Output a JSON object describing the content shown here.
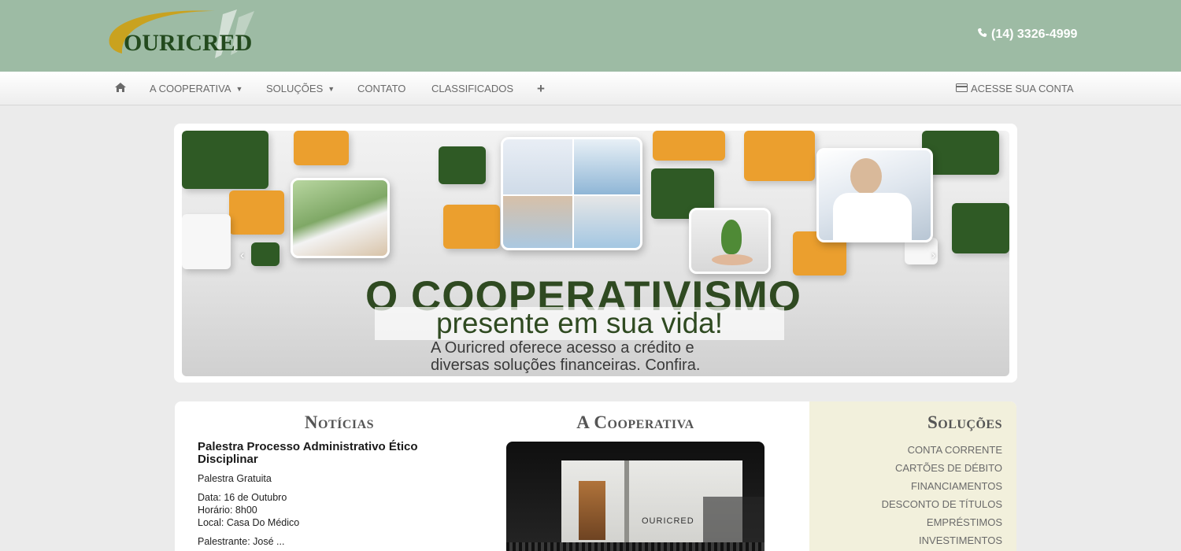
{
  "header": {
    "logo_text": "OURICRED",
    "phone": "(14) 3326-4999",
    "phone_icon": "phone-icon",
    "bg_color": "#9dbba4"
  },
  "nav": {
    "home_icon": "home-icon",
    "items": [
      {
        "label": "A COOPERATIVA",
        "dropdown": true
      },
      {
        "label": "SOLUÇÕES",
        "dropdown": true
      },
      {
        "label": "CONTATO",
        "dropdown": false
      },
      {
        "label": "CLASSIFICADOS",
        "dropdown": false
      }
    ],
    "more_label": "+",
    "account_label": "ACESSE SUA CONTA",
    "account_icon": "credit-card-icon"
  },
  "carousel": {
    "title": "O COOPERATIVISMO",
    "subtitle": "presente em sua vida!",
    "description_line1": "A Ouricred oferece acesso a crédito e",
    "description_line2": "diversas soluções financeiras. Confira.",
    "prev_label": "‹",
    "next_label": "›",
    "accent_green": "#2f5a25",
    "accent_orange": "#eb9f2e"
  },
  "noticias": {
    "title": "Notícias",
    "headline": "Palestra Processo Administrativo Ético Disciplinar",
    "lines": [
      "Palestra Gratuita",
      "Data: 16 de Outubro",
      "Horário: 8h00",
      "Local: Casa Do Médico",
      "Palestrante: José ..."
    ]
  },
  "cooperativa": {
    "title": "A Cooperativa",
    "building_sign": "OURICRED"
  },
  "solucoes": {
    "title": "Soluções",
    "items": [
      "CONTA CORRENTE",
      "CARTÕES DE DÉBITO",
      "FINANCIAMENTOS",
      "DESCONTO DE TÍTULOS",
      "EMPRÉSTIMOS",
      "INVESTIMENTOS"
    ],
    "bg_color": "#f2f0dc"
  }
}
